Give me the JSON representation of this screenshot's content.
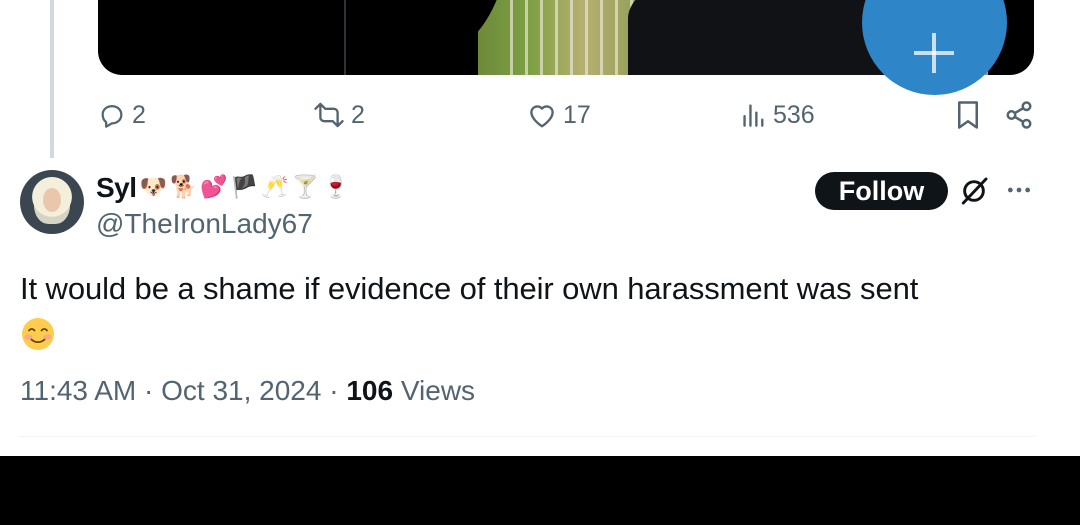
{
  "previous_tweet": {
    "actions": {
      "replies": "2",
      "reposts": "2",
      "likes": "17",
      "views": "536"
    },
    "icons": [
      "reply-icon",
      "repost-icon",
      "like-icon",
      "views-icon",
      "bookmark-icon",
      "share-icon"
    ]
  },
  "tweet": {
    "display_name": "Syl",
    "name_emojis": [
      "🐶",
      "🐕",
      "💕",
      "🏴",
      "🥂",
      "🍸",
      "🍷"
    ],
    "handle": "@TheIronLady67",
    "follow_label": "Follow",
    "text": "It would be a shame if evidence of their own harassment was sent",
    "trailing_emoji": "☺️",
    "time": "11:43 AM",
    "separator": " · ",
    "date": "Oct 31, 2024",
    "views_count": "106",
    "views_label": " Views"
  },
  "colors": {
    "text_primary": "#0f1419",
    "text_secondary": "#536471",
    "fab_blue": "#2e85c8",
    "follow_bg": "#0f1419"
  }
}
